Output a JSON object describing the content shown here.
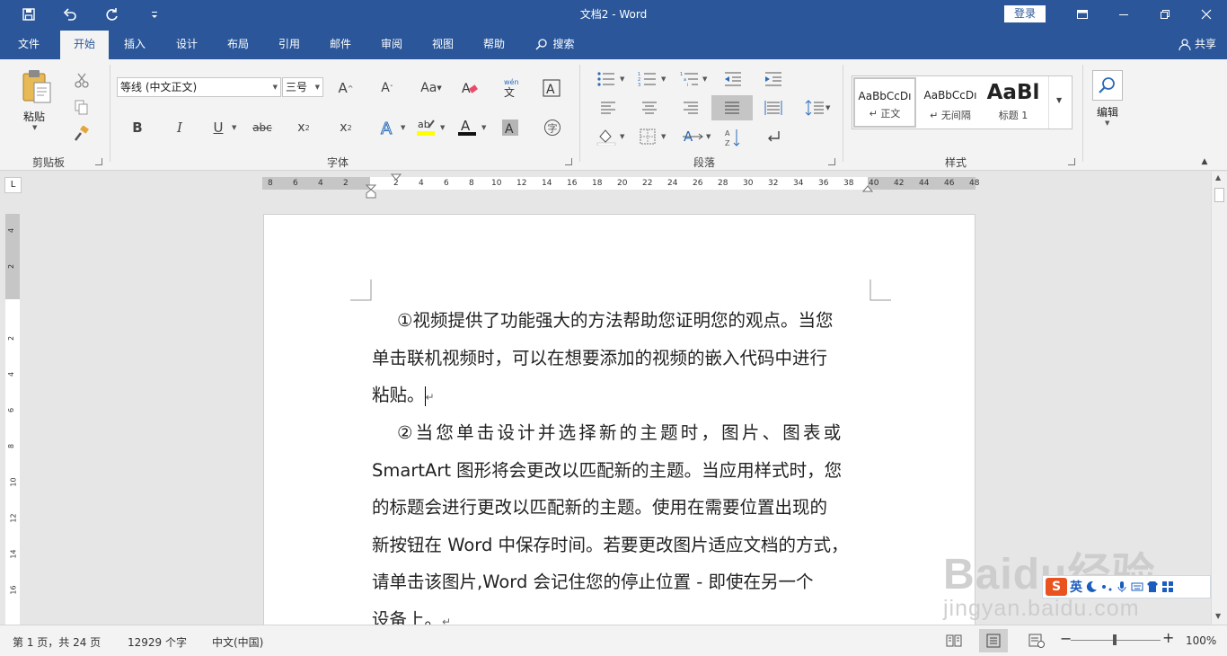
{
  "app": {
    "doc_title": "文档2  -  Word",
    "login_label": "登录",
    "share_label": "共享"
  },
  "tabs": [
    {
      "label": "文件"
    },
    {
      "label": "开始"
    },
    {
      "label": "插入"
    },
    {
      "label": "设计"
    },
    {
      "label": "布局"
    },
    {
      "label": "引用"
    },
    {
      "label": "邮件"
    },
    {
      "label": "审阅"
    },
    {
      "label": "视图"
    },
    {
      "label": "帮助"
    },
    {
      "label": "搜索"
    }
  ],
  "ribbon": {
    "clipboard": {
      "group_label": "剪贴板",
      "paste_label": "粘贴"
    },
    "font": {
      "group_label": "字体",
      "font_name": "等线 (中文正文)",
      "font_size": "三号"
    },
    "paragraph": {
      "group_label": "段落"
    },
    "styles": {
      "group_label": "样式",
      "items": [
        {
          "preview": "AaBbCcDı",
          "name": "↵ 正文"
        },
        {
          "preview": "AaBbCcDı",
          "name": "↵ 无间隔"
        },
        {
          "preview": "AaBl",
          "name": "标题 1"
        }
      ]
    },
    "editing": {
      "group_label": "编辑"
    }
  },
  "ruler": {
    "h_ticks": [
      "8",
      "6",
      "4",
      "2",
      "",
      "2",
      "4",
      "6",
      "8",
      "10",
      "12",
      "14",
      "16",
      "18",
      "20",
      "22",
      "24",
      "26",
      "28",
      "30",
      "32",
      "34",
      "36",
      "38",
      "40",
      "42",
      "44",
      "46",
      "48"
    ],
    "v_ticks": [
      "4",
      "2",
      "",
      "2",
      "4",
      "6",
      "8",
      "10",
      "12",
      "14",
      "16"
    ]
  },
  "document": {
    "paragraphs": [
      {
        "lines": [
          "①视频提供了功能强大的方法帮助您证明您的观点。当您",
          "单击联机视频时，可以在想要添加的视频的嵌入代码中进行",
          "粘贴。"
        ]
      },
      {
        "lines": [
          "②当您单击设计并选择新的主题时，图片、图表或",
          "SmartArt 图形将会更改以匹配新的主题。当应用样式时，您",
          "的标题会进行更改以匹配新的主题。使用在需要位置出现的",
          "新按钮在 Word 中保存时间。若要更改图片适应文档的方式，",
          "请单击该图片,Word 会记住您的停止位置 - 即使在另一个",
          "设备上。"
        ]
      }
    ],
    "para_mark": "↵"
  },
  "status": {
    "page": "第 1 页，共 24 页",
    "words": "12929 个字",
    "language": "中文(中国)",
    "zoom": "100%"
  },
  "watermark": {
    "logo": "Baidu经验",
    "url": "jingyan.baidu.com"
  },
  "ime": {
    "mode": "英"
  }
}
